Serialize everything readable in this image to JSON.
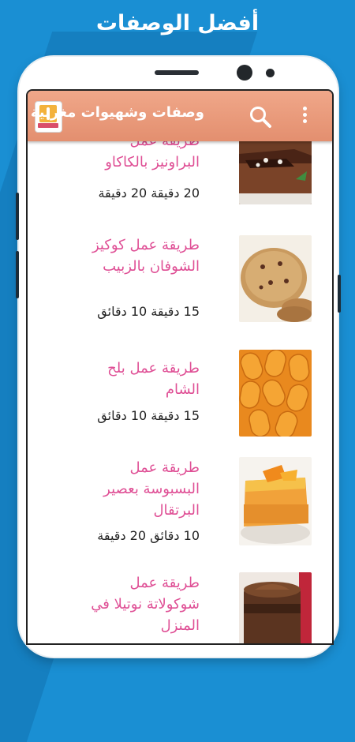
{
  "promo": {
    "title": "أفضل الوصفات"
  },
  "app": {
    "title": "وصفات وشهيوات مغربية",
    "icon_name": "app-logo-icon",
    "search_icon": "search-icon",
    "menu_icon": "overflow-menu-icon",
    "bar_color": "#e9987a"
  },
  "recipes": [
    {
      "title": "طريقة عمل البراونيز بالكاكاو",
      "time": "20 دقيقة 20 دقيقة"
    },
    {
      "title": "طريقة عمل كوكيز الشوفان بالزبيب",
      "time": "15 دقيقة 10 دقائق"
    },
    {
      "title": "طريقة عمل بلح الشام",
      "time": "15 دقيقة 10 دقائق"
    },
    {
      "title": "طريقة عمل البسبوسة بعصير البرتقال",
      "time": "10 دقائق 20 دقيقة"
    },
    {
      "title": "طريقة عمل شوكولاتة نوتيلا في المنزل",
      "time": ""
    }
  ],
  "colors": {
    "title_pink": "#df4f95",
    "background_blue": "#1a8fd3"
  }
}
